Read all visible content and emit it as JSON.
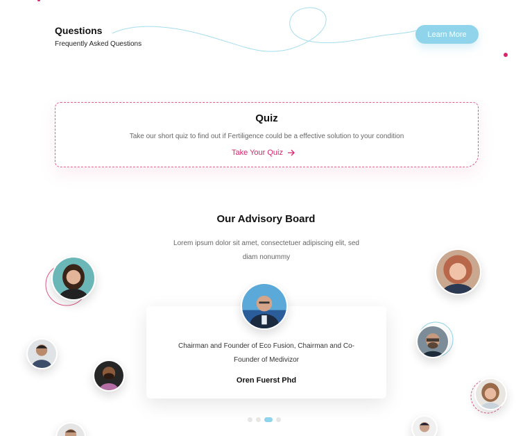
{
  "faq": {
    "title": "Questions",
    "subtitle": "Frequently Asked Questions",
    "button_label": "Learn More"
  },
  "quiz": {
    "title": "Quiz",
    "description": "Take our short quiz to find out if Fertiligence could be a effective solution to your condition",
    "link_label": "Take Your Quiz"
  },
  "advisory": {
    "title": "Our Advisory Board",
    "description": "Lorem ipsum dolor sit amet, consectetuer adipiscing elit, sed diam nonummy",
    "featured": {
      "role": "Chairman and Founder of Eco Fusion, Chairman and Co-Founder of Medivizor",
      "name": "Oren Fuerst Phd"
    },
    "carousel_pages": 4,
    "active_page": 3
  },
  "colors": {
    "accent_pink": "#d6246d",
    "accent_blue": "#8fd4ea"
  }
}
